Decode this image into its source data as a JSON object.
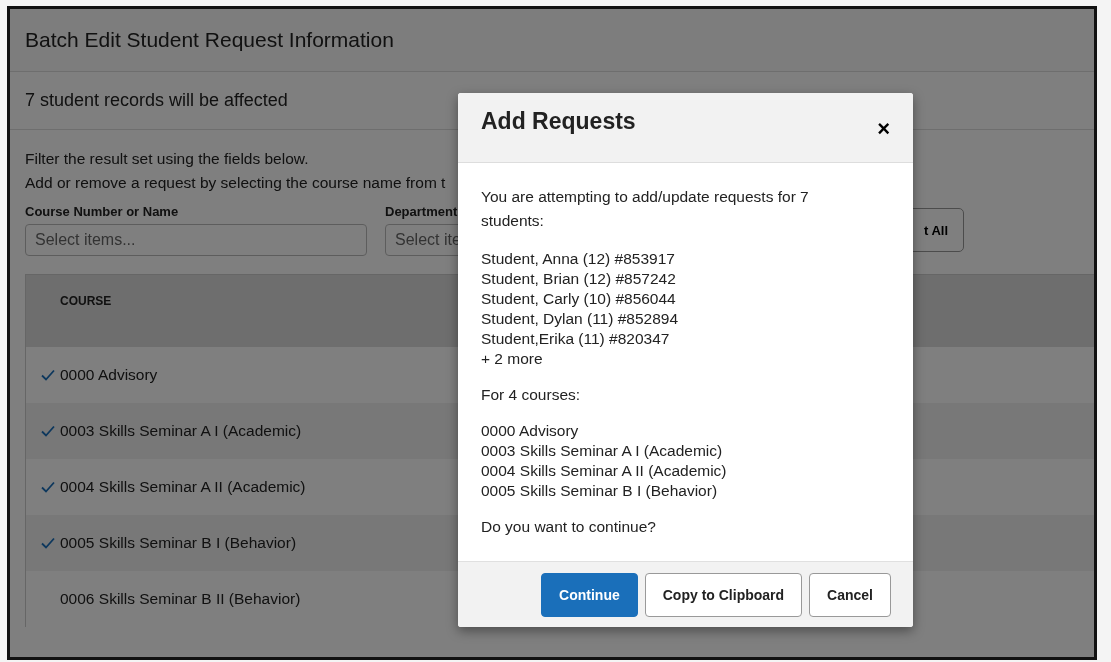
{
  "window": {
    "title": "Batch Edit Student Request Information"
  },
  "summary": "7 student records will be affected",
  "instructions": [
    "Filter the result set using the fields below.",
    "Add or remove a request by selecting the course name from t"
  ],
  "filters": [
    {
      "label": "Course Number or Name",
      "placeholder": "Select items..."
    },
    {
      "label": "Department",
      "placeholder": "Select ite"
    }
  ],
  "select_all_button": "t All",
  "table": {
    "columns": [
      "COURSE"
    ],
    "rows": [
      {
        "course": "0000 Advisory",
        "checked": true
      },
      {
        "course": "0003 Skills Seminar A I (Academic)",
        "checked": true
      },
      {
        "course": "0004 Skills Seminar A II (Academic)",
        "checked": true
      },
      {
        "course": "0005 Skills Seminar B I (Behavior)",
        "checked": true
      },
      {
        "course": "0006 Skills Seminar B II (Behavior)",
        "checked": false
      }
    ]
  },
  "dialog": {
    "title": "Add Requests",
    "close": "×",
    "intro": "You are attempting to add/update requests for 7 students:",
    "students": [
      "Student, Anna (12) #853917",
      "Student, Brian (12) #857242",
      "Student, Carly (10) #856044",
      "Student, Dylan (11) #852894",
      "Student,Erika (11) #820347",
      "+ 2 more"
    ],
    "courses_intro": "For 4 courses:",
    "courses": [
      "0000 Advisory",
      "0003 Skills Seminar A I (Academic)",
      "0004 Skills Seminar A II (Academic)",
      "0005 Skills Seminar B I (Behavior)"
    ],
    "question": "Do you want to continue?",
    "buttons": [
      {
        "label": "Continue",
        "kind": "primary"
      },
      {
        "label": "Copy to Clipboard",
        "kind": "secondary"
      },
      {
        "label": "Cancel",
        "kind": "secondary"
      }
    ]
  }
}
